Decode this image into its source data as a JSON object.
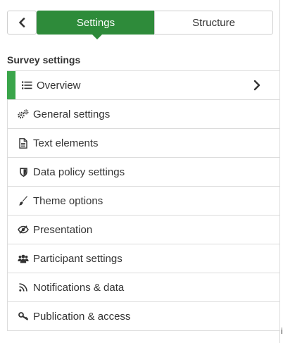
{
  "top_bar": {
    "tabs": [
      {
        "label": "Settings",
        "active": true
      },
      {
        "label": "Structure",
        "active": false
      }
    ]
  },
  "section": {
    "title": "Survey settings"
  },
  "menu": {
    "items": [
      {
        "label": "Overview",
        "icon": "list-icon",
        "active": true
      },
      {
        "label": "General settings",
        "icon": "gears-icon",
        "active": false
      },
      {
        "label": "Text elements",
        "icon": "document-icon",
        "active": false
      },
      {
        "label": "Data policy settings",
        "icon": "shield-icon",
        "active": false
      },
      {
        "label": "Theme options",
        "icon": "paintbrush-icon",
        "active": false
      },
      {
        "label": "Presentation",
        "icon": "eye-slash-icon",
        "active": false
      },
      {
        "label": "Participant settings",
        "icon": "users-icon",
        "active": false
      },
      {
        "label": "Notifications & data",
        "icon": "rss-icon",
        "active": false
      },
      {
        "label": "Publication & access",
        "icon": "key-icon",
        "active": false
      }
    ]
  },
  "edge_mark": "i",
  "colors": {
    "accent": "#2e8b3a",
    "active_bar": "#3aa54a",
    "border": "#dcdcdc"
  }
}
